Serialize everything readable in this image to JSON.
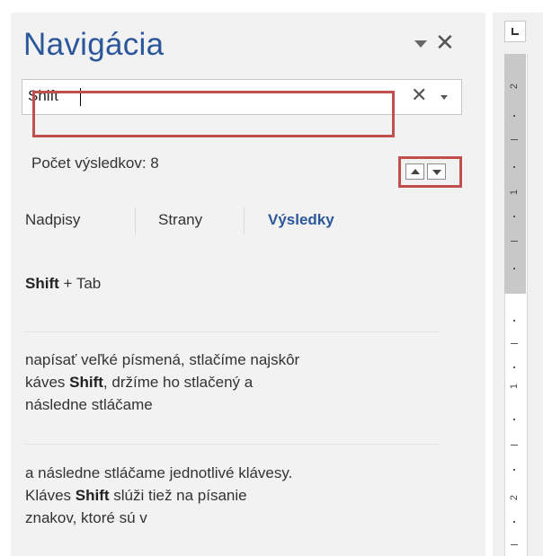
{
  "pane": {
    "title": "Navigácia",
    "menu_icon": "dropdown-triangle-icon",
    "close_icon": "close-icon"
  },
  "search": {
    "value": "Shift",
    "clear_icon": "clear-x-icon",
    "options_icon": "dropdown-triangle-icon"
  },
  "results": {
    "count_label": "Počet výsledkov: 8",
    "prev_icon": "up-triangle-icon",
    "next_icon": "down-triangle-icon"
  },
  "tabs": [
    {
      "label": "Nadpisy"
    },
    {
      "label": "Strany"
    },
    {
      "label": "Výsledky"
    }
  ],
  "result_items": [
    {
      "parts": [
        {
          "t": "Shift",
          "b": true
        },
        {
          "t": " + Tab",
          "b": false
        }
      ]
    },
    {
      "parts": [
        {
          "t": "napísať veľké písmená, stlačíme najskôr\nkáves ",
          "b": false
        },
        {
          "t": "Shift",
          "b": true
        },
        {
          "t": ", držíme ho stlačený a\nnásledne stláčame",
          "b": false
        }
      ]
    },
    {
      "parts": [
        {
          "t": "a následne stláčame jednotlivé klávesy.\nKláves ",
          "b": false
        },
        {
          "t": "Shift",
          "b": true
        },
        {
          "t": " slúži tiež na písanie\nznakov, ktoré sú v",
          "b": false
        }
      ]
    }
  ],
  "ruler": {
    "numbers": [
      "2",
      "1",
      "1",
      "2"
    ]
  },
  "colors": {
    "accent": "#2b579a",
    "highlight_box": "#c0504d"
  }
}
